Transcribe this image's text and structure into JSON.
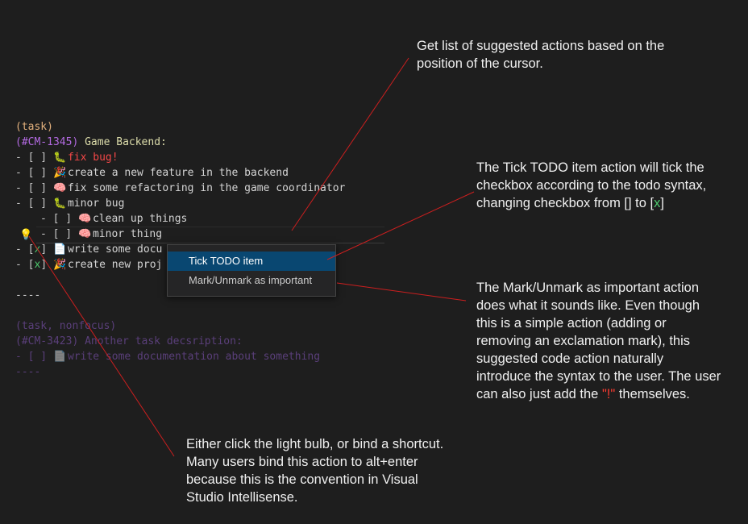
{
  "editor": {
    "lines": [
      {
        "tag": "(task)"
      },
      {
        "id": "(#CM-1345)",
        "title": " Game Backend:"
      },
      {
        "prefix": "- [ ] ",
        "emoji": "🐛",
        "text": "fix bug!"
      },
      {
        "prefix": "- [ ] ",
        "emoji": "🎉",
        "text": "create a new feature in the backend"
      },
      {
        "prefix": "- [ ] ",
        "emoji": "🧠",
        "text": "fix some refactoring in the game coordinator"
      },
      {
        "prefix": "- [ ] ",
        "emoji": "🐛",
        "text": "minor bug"
      },
      {
        "prefix": "- [ ] ",
        "emoji": "🧠",
        "text": "clean up things"
      },
      {
        "prefix": "- [ ] ",
        "emoji": "🧠",
        "text": "minor thing"
      },
      {
        "dash": "- [",
        "mark": "x",
        "close": "] ",
        "emoji": "📄",
        "text": "write some docu"
      },
      {
        "dash": "- [",
        "mark": "x",
        "close": "] ",
        "emoji": "🎉",
        "text": "create new proj"
      },
      {
        "text": ""
      },
      {
        "text": "----"
      },
      {
        "text": ""
      },
      {
        "text": "(task, nonfocus)"
      },
      {
        "text": "(#CM-3423) Another task decsription:"
      },
      {
        "prefix": "- [ ] ",
        "emoji": "📄",
        "text": "write some documentation about something"
      },
      {
        "text": "----"
      }
    ]
  },
  "lightbulb": {
    "icon": "lightbulb-icon",
    "glyph": "💡",
    "color": "#ffcc00"
  },
  "context_menu": {
    "items": [
      "Tick TODO item",
      "Mark/Unmark as important"
    ],
    "active_color": "#094771"
  },
  "annotations": {
    "cursor": {
      "lines": [
        "Get list of suggested actions based on the",
        "position of the cursor."
      ]
    },
    "tick": {
      "line1": "The Tick TODO item action will tick the",
      "line2": "checkbox according to the todo syntax,",
      "line3_pre": "changing checkbox from [] to [",
      "line3_mark": "x",
      "line3_post": "]"
    },
    "mark": {
      "lines": [
        "The Mark/Unmark as important action",
        "does what it sounds like. Even though",
        "this is a simple action (adding or",
        "removing an exclamation mark), this",
        "suggested code action naturally",
        "introduce the syntax to the user. The user"
      ],
      "last_pre": "can also just add the ",
      "last_mark": "\"!\"",
      "last_post": " themselves."
    },
    "bulb": {
      "lines": [
        "Either click the light bulb, or bind a shortcut.",
        "Many users bind this action to alt+enter",
        "because this is the convention in Visual",
        "Studio Intellisense."
      ]
    }
  },
  "colors": {
    "background": "#1e1e1e",
    "annotation_line": "#cc1f1f",
    "check_green": "#4ec96e",
    "todo_red": "#f44747"
  }
}
